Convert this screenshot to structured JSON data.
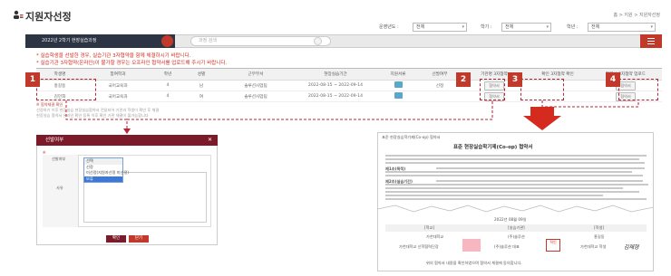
{
  "header": {
    "title": "지원자선정",
    "breadcrumb": "홈 > 지원 > 지원자선정",
    "filters": [
      {
        "label": "운영년도 :",
        "value": "전체"
      },
      {
        "label": "학기 :",
        "value": "전체"
      },
      {
        "label": "학년 :",
        "value": "전체"
      }
    ]
  },
  "toolbar": {
    "program_label": "2022년 2학기 현장실습과정",
    "search_placeholder": "과정 검색",
    "menu_icon": "hamburger-icon",
    "accent_color": "#c0392b",
    "dark_color": "#2d3444"
  },
  "notices": [
    "* 실습학생을 선발한 경우, 실습기관 3자협약을 함께 체결하시기 바랍니다.",
    "* 실습기관 3자협약(온라인)이 불가할 경우는 오프라인 협약서를 업로드해 주시기 바랍니다."
  ],
  "table": {
    "columns": [
      "학생명",
      "참여학과",
      "학년",
      "성별",
      "근무부서",
      "현장실습기간",
      "지원서류",
      "선발여부",
      "기관명 3자협약",
      "확인 3자협약 확인",
      "협약서 3자협약 업로드"
    ],
    "rows": [
      {
        "name": "홍길동",
        "dept": "국어교육과",
        "grade": "4",
        "gender": "남",
        "office": "솔루션사업팀",
        "period": "2022-08-15 ~ 2022-09-14",
        "status": "선정",
        "btn1": "협약서",
        "btn2": "협약서"
      },
      {
        "name": "김민희",
        "dept": "국어교육과",
        "grade": "4",
        "gender": "여",
        "office": "솔루션사업팀",
        "period": "2022-08-15 ~ 2022-09-14",
        "status": "",
        "btn1": "협약서",
        "btn2": "협약서"
      }
    ],
    "notes": [
      "※ 협약체결 확인",
      "선정하기 이후 현장실습 현장실습협약서 전달되어 기관과 학생이 확인 후 체결",
      "현장실습 협약서 온라인 확인 등록 이후 확인 기관 체결이 불가능합니다"
    ]
  },
  "markers": [
    "1",
    "2",
    "3",
    "4"
  ],
  "popup": {
    "title": "선발여부",
    "field1_label": "선발여부",
    "field2_label": "사유",
    "select_value": "선택",
    "options": [
      "선택",
      "선정",
      "미선정(지원자선정 미선정)",
      "보류"
    ],
    "confirm": "확인",
    "close": "닫기"
  },
  "document": {
    "header_small": "표준 현장실습학기제(Co-op) 협약서",
    "title": "표준 현장실습학기제(Co-op) 협약서",
    "section1": "제1조(목적)",
    "section2": "제2조(실습기간)",
    "date": "2022년 08월 09일",
    "party1": "[학교]",
    "party2": "[실습기관]",
    "party3": "[학생]",
    "party1_name": "가천대학교",
    "party2_name": "(주)솔루션",
    "party3_name": "홍길동",
    "sign1": "가천대학교 산학협력단장",
    "sign2": "(주)솔루션 대표",
    "sign3": "가천대학교 학생",
    "signature": "김재형",
    "footer": "위의 협약서 내용을 확인하였으며 협약서 체결에 동의합니다."
  }
}
